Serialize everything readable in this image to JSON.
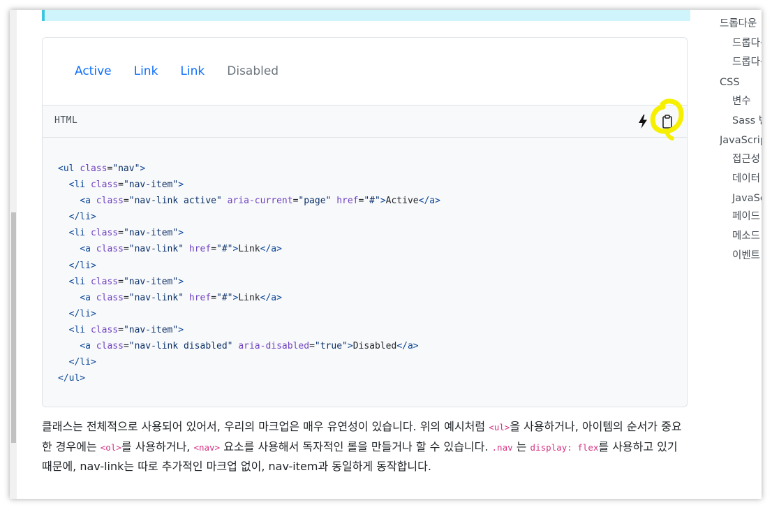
{
  "preview": {
    "nav_links": [
      {
        "label": "Active"
      },
      {
        "label": "Link"
      },
      {
        "label": "Link"
      },
      {
        "label": "Disabled"
      }
    ]
  },
  "code": {
    "language": "HTML",
    "icons": [
      "lightning-icon",
      "clipboard-icon"
    ],
    "annotation_color": "#f6f000"
  },
  "prose": {
    "s1": "클래스는 전체적으로 사용되어 있어서, 우리의 마크업은 매우 유연성이 있습니다. 위의 예시처럼 ",
    "c1": "<ul>",
    "s2": "을 사용하거나, 아이템의 순서가 중요한 경우에는 ",
    "c2": "<ol>",
    "s3": "를 사용하거나, ",
    "c3": "<nav>",
    "s4": " 요소를 사용해서 독자적인 롤을 만들거나 할 수 있습니다. ",
    "c4": ".nav",
    "s5": " 는 ",
    "c5": "display: flex",
    "s6": "를 사용하고 있기 때문에, nav-link는 따로 추가적인 마크업 없이, nav-item과 동일하게 동작합니다."
  },
  "toc": [
    {
      "label": "드롭다운",
      "sub": false
    },
    {
      "label": "드롭다운",
      "sub": true
    },
    {
      "label": "드롭다운",
      "sub": true
    },
    {
      "label": "CSS",
      "sub": false
    },
    {
      "label": "변수",
      "sub": true
    },
    {
      "label": "Sass 변수",
      "sub": true
    },
    {
      "label": "JavaScript",
      "sub": false
    },
    {
      "label": "접근성",
      "sub": true
    },
    {
      "label": "데이터",
      "sub": true
    },
    {
      "label": "JavaScript",
      "sub": true
    },
    {
      "label": "페이드",
      "sub": true
    },
    {
      "label": "메소드",
      "sub": true
    },
    {
      "label": "이벤트",
      "sub": true
    }
  ]
}
